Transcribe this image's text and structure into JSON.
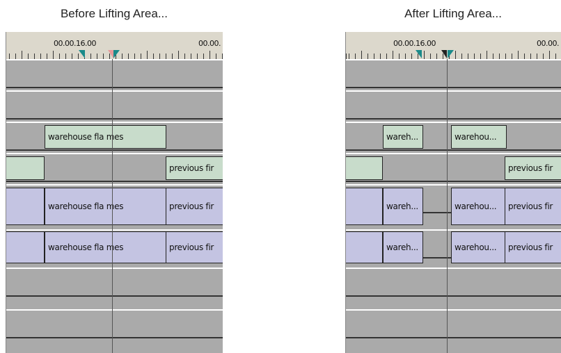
{
  "captions": {
    "before": "Before Lifting Area...",
    "after": "After Lifting Area..."
  },
  "before": {
    "timecode_1": "00.00.16.00",
    "timecode_2": "00.00.",
    "clips": {
      "v_flames": "warehouse fla  mes",
      "v_prev": "previous fir",
      "a1_flames": "warehouse fla  mes",
      "a1_prev": "previous fir",
      "a2_flames": "warehouse fla  mes",
      "a2_prev": "previous fir"
    }
  },
  "after": {
    "timecode_1": "00.00.16.00",
    "timecode_2": "00.00.",
    "clips": {
      "v_left": "wareh...",
      "v_right": "warehou...",
      "v_prev": "previous fir",
      "a1_left": "wareh...",
      "a1_right": "warehou...",
      "a1_prev": "previous fir",
      "a2_left": "wareh...",
      "a2_right": "warehou...",
      "a2_prev": "previous fir"
    }
  },
  "colors": {
    "video_clip": "#c8dccb",
    "audio_clip": "#c4c4e2",
    "track_bg": "#aaaaaa",
    "ruler_bg": "#dcd8cc",
    "marker_teal": "#1a8a8a",
    "marker_pink": "#e89a9a"
  }
}
